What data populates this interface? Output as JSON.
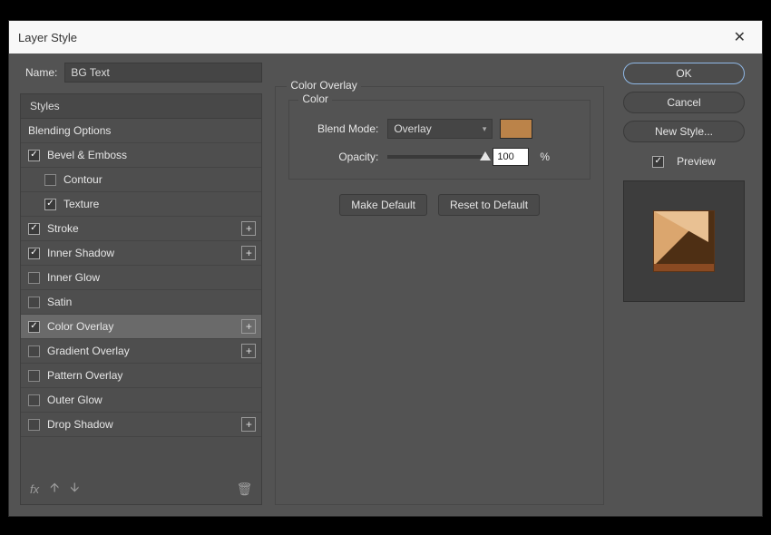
{
  "dialog": {
    "title": "Layer Style"
  },
  "name": {
    "label": "Name:",
    "value": "BG Text"
  },
  "stylesHeader": "Styles",
  "styles": {
    "blendingOptions": "Blending Options",
    "bevel": "Bevel & Emboss",
    "contour": "Contour",
    "texture": "Texture",
    "stroke": "Stroke",
    "innerShadow": "Inner Shadow",
    "innerGlow": "Inner Glow",
    "satin": "Satin",
    "colorOverlay": "Color Overlay",
    "gradientOverlay": "Gradient Overlay",
    "patternOverlay": "Pattern Overlay",
    "outerGlow": "Outer Glow",
    "dropShadow": "Drop Shadow"
  },
  "fxLabel": "fx",
  "panel": {
    "title": "Color Overlay",
    "group": "Color",
    "blendModeLabel": "Blend Mode:",
    "blendModeValue": "Overlay",
    "opacityLabel": "Opacity:",
    "opacityValue": "100",
    "pct": "%",
    "makeDefault": "Make Default",
    "resetDefault": "Reset to Default",
    "swatchColor": "#bb8349"
  },
  "buttons": {
    "ok": "OK",
    "cancel": "Cancel",
    "newStyle": "New Style...",
    "preview": "Preview"
  }
}
